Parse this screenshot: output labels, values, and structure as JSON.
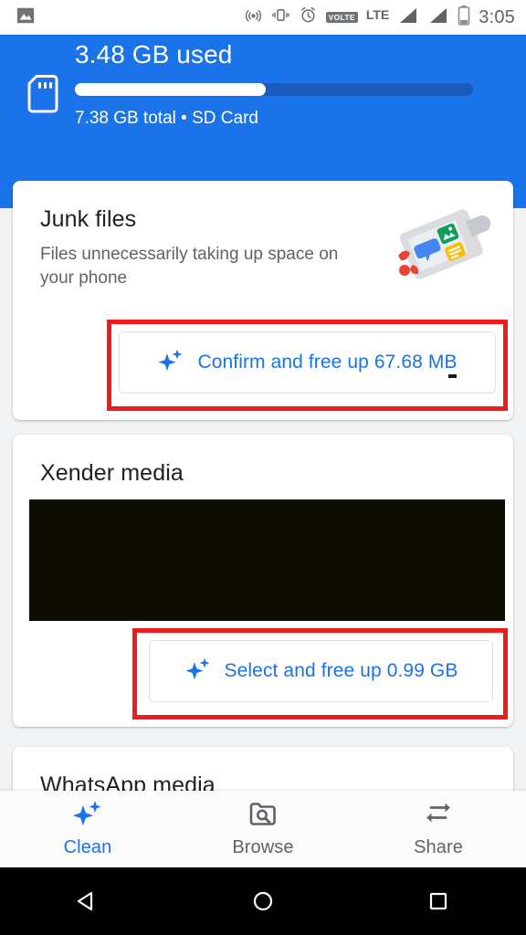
{
  "status_bar": {
    "notification_icon": "image-icon",
    "icons": [
      "hotspot-icon",
      "vibrate-icon",
      "alarm-icon"
    ],
    "volte_badge": "VOLTE",
    "network_type": "LTE",
    "signal_icons": [
      "signal-bar-icon",
      "signal-bar-icon"
    ],
    "battery_icon": "battery-icon",
    "clock": "3:05"
  },
  "storage_header": {
    "used_label": "3.48 GB used",
    "total_label": "7.38 GB total • SD Card",
    "progress_percent": 48,
    "sd_icon": "sd-card-icon",
    "bg_color": "#1a73e8",
    "track_color": "#1b5bbd",
    "fill_color": "#ffffff"
  },
  "cards": [
    {
      "id": "junk-files",
      "title": "Junk files",
      "description": "Files unnecessarily taking up space on your phone",
      "illustration": "dustpan-with-files-icon",
      "button": {
        "label": "Confirm and free up 67.68 MB",
        "icon": "sparkle-icon",
        "color": "#1a73e8",
        "highlighted": true
      }
    },
    {
      "id": "xender-media",
      "title": "Xender media",
      "thumbnail_strip": "redacted-black",
      "button": {
        "label": "Select and free up 0.99 GB",
        "icon": "sparkle-icon",
        "color": "#1a73e8",
        "highlighted": true
      }
    },
    {
      "id": "whatsapp-media",
      "title": "WhatsApp media"
    }
  ],
  "annotations": {
    "highlight_color": "#ee1c1c",
    "count": 2
  },
  "bottom_nav": {
    "items": [
      {
        "label": "Clean",
        "icon": "sparkle-icon",
        "active": true
      },
      {
        "label": "Browse",
        "icon": "folder-search-icon",
        "active": false
      },
      {
        "label": "Share",
        "icon": "transfer-arrows-icon",
        "active": false
      }
    ],
    "active_color": "#1a73e8",
    "inactive_color": "#5f6368"
  },
  "android_nav": {
    "back": "back-triangle-icon",
    "home": "home-circle-icon",
    "recents": "recents-square-icon"
  }
}
